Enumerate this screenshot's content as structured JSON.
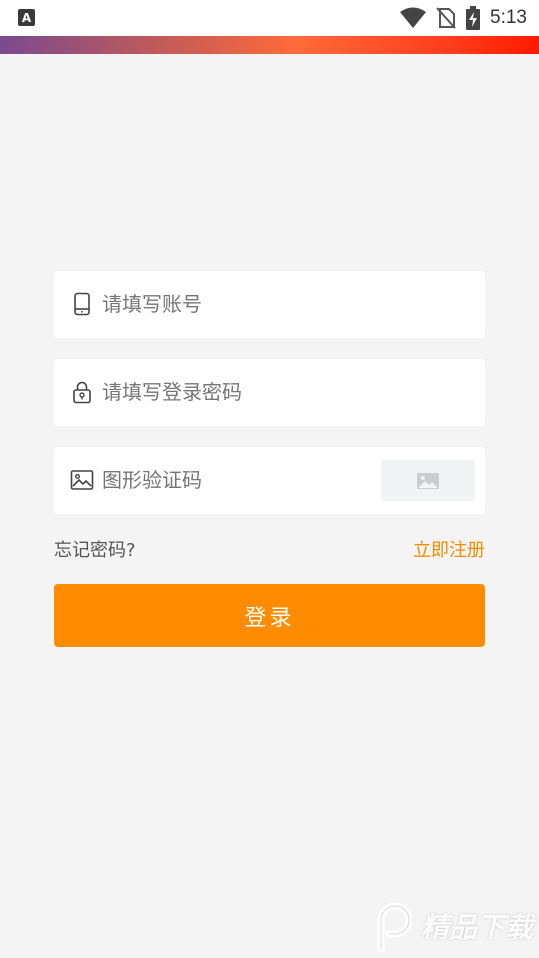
{
  "status_bar": {
    "app_badge": "A",
    "time": "5:13",
    "icons": [
      "wifi-icon",
      "no-sim-icon",
      "battery-charging-icon"
    ]
  },
  "form": {
    "account_placeholder": "请填写账号",
    "password_placeholder": "请填写登录密码",
    "captcha_placeholder": "图形验证码"
  },
  "links": {
    "forgot_password": "忘记密码?",
    "register": "立即注册"
  },
  "login_button": "登录",
  "watermark": "精品下载",
  "colors": {
    "accent": "#ff8c00",
    "link": "#f28c00",
    "background": "#f4f4f4"
  }
}
